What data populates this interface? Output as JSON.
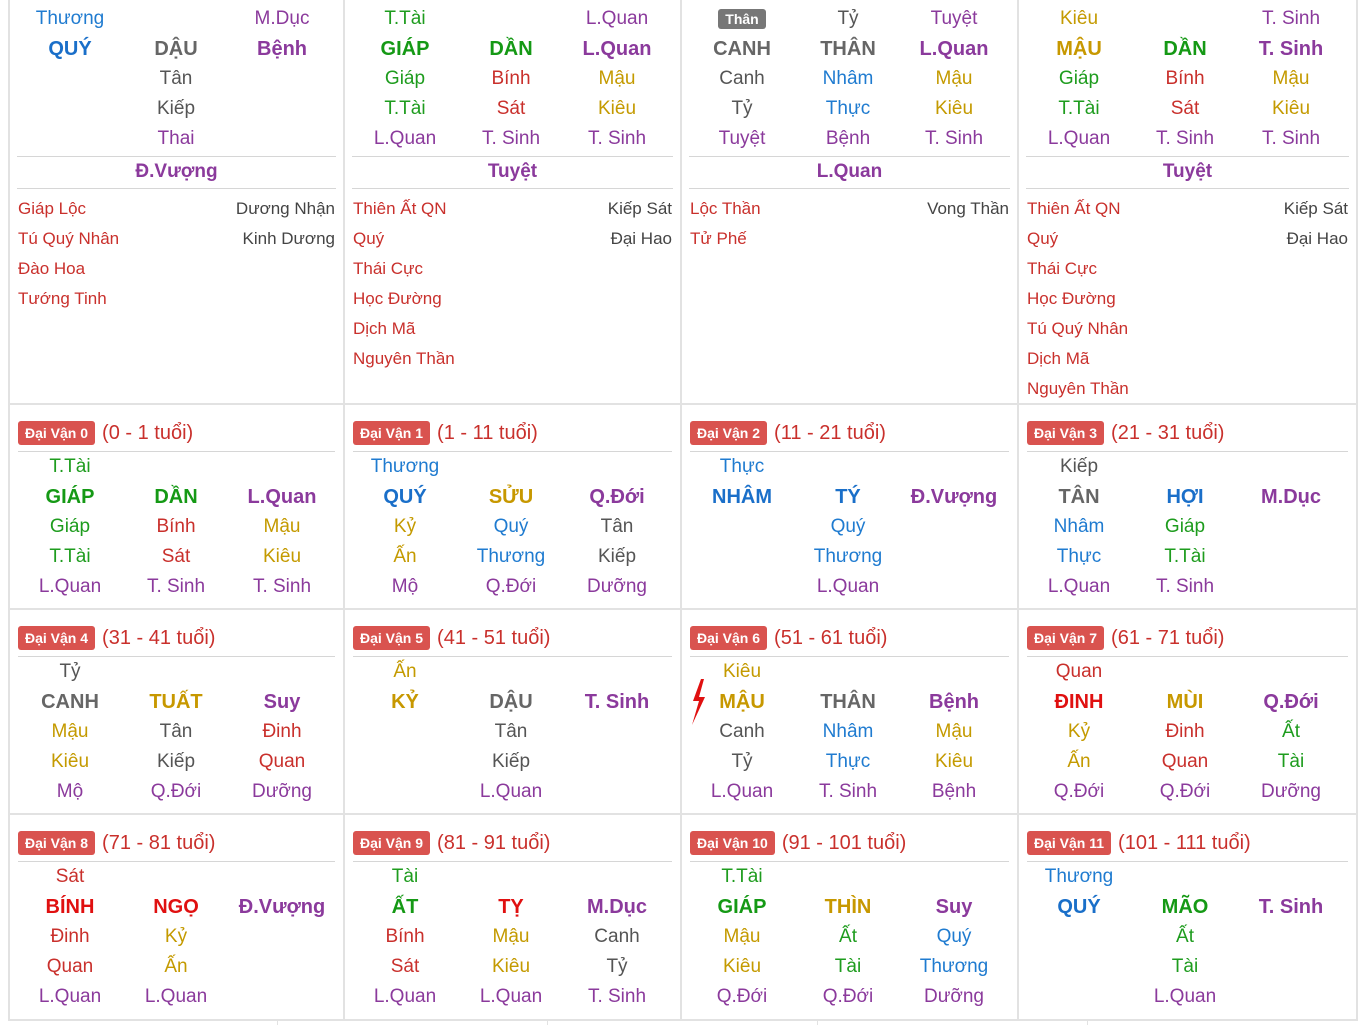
{
  "colors": {
    "red": "#c9302c",
    "pinkred": "#e01010",
    "blue": "#1f7bd0",
    "blue_b": "#1a6fc9",
    "green": "#1e9c1e",
    "green_b": "#159915",
    "olive": "#c49a00",
    "olive_b": "#c79800",
    "gray": "#555555",
    "gray_b": "#666666",
    "purple": "#8b3a9c",
    "purple_b": "#8d2f95",
    "badge": "#d9534f"
  },
  "pillars": [
    {
      "rows": [
        [
          "Thương",
          "",
          "M.Dục"
        ],
        [
          "QUÝ",
          "DẬU",
          "Bệnh"
        ],
        [
          "",
          "Tân",
          ""
        ],
        [
          "",
          "Kiếp",
          ""
        ],
        [
          "",
          "Thai",
          ""
        ]
      ],
      "colors": [
        [
          "blue",
          "",
          "purple"
        ],
        [
          "blue_b",
          "gray_b",
          "purple"
        ],
        [
          "",
          "gray",
          ""
        ],
        [
          "",
          "gray",
          ""
        ],
        [
          "",
          "purple",
          ""
        ]
      ],
      "center": "Đ.Vượng",
      "stars_left": [
        "Giáp Lộc",
        "Tú Quý Nhân",
        "Đào Hoa",
        "Tướng Tinh"
      ],
      "stars_right": [
        "Dương Nhận",
        "Kinh Dương"
      ]
    },
    {
      "rows": [
        [
          "T.Tài",
          "",
          "L.Quan"
        ],
        [
          "GIÁP",
          "DẦN",
          "L.Quan"
        ],
        [
          "Giáp",
          "Bính",
          "Mậu"
        ],
        [
          "T.Tài",
          "Sát",
          "Kiêu"
        ],
        [
          "L.Quan",
          "T. Sinh",
          "T. Sinh"
        ]
      ],
      "colors": [
        [
          "green",
          "",
          "purple"
        ],
        [
          "green_b",
          "green_b",
          "purple"
        ],
        [
          "green",
          "red",
          "olive"
        ],
        [
          "green",
          "red",
          "olive"
        ],
        [
          "purple",
          "purple",
          "purple"
        ]
      ],
      "center": "Tuyệt",
      "stars_left": [
        "Thiên Ất QN",
        "Quý",
        "Thái Cực",
        "Học Đường",
        "Dịch Mã",
        "Nguyên Thần"
      ],
      "stars_right": [
        "Kiếp Sát",
        "Đại Hao"
      ]
    },
    {
      "badge": "Thân",
      "rows": [
        [
          "",
          "Tỷ",
          "Tuyệt"
        ],
        [
          "CANH",
          "THÂN",
          "L.Quan"
        ],
        [
          "Canh",
          "Nhâm",
          "Mậu"
        ],
        [
          "Tỷ",
          "Thực",
          "Kiêu"
        ],
        [
          "Tuyệt",
          "Bệnh",
          "T. Sinh"
        ]
      ],
      "colors": [
        [
          "",
          "gray",
          "purple"
        ],
        [
          "gray_b",
          "gray_b",
          "purple"
        ],
        [
          "gray",
          "blue",
          "olive"
        ],
        [
          "gray",
          "blue",
          "olive"
        ],
        [
          "purple",
          "purple",
          "purple"
        ]
      ],
      "center": "L.Quan",
      "stars_left": [
        "Lộc Thần",
        "Tử Phế"
      ],
      "stars_right": [
        "Vong Thần"
      ]
    },
    {
      "rows": [
        [
          "Kiêu",
          "",
          "T. Sinh"
        ],
        [
          "MẬU",
          "DẦN",
          "T. Sinh"
        ],
        [
          "Giáp",
          "Bính",
          "Mậu"
        ],
        [
          "T.Tài",
          "Sát",
          "Kiêu"
        ],
        [
          "L.Quan",
          "T. Sinh",
          "T. Sinh"
        ]
      ],
      "colors": [
        [
          "olive",
          "",
          "purple"
        ],
        [
          "olive_b",
          "green_b",
          "purple"
        ],
        [
          "green",
          "red",
          "olive"
        ],
        [
          "green",
          "red",
          "olive"
        ],
        [
          "purple",
          "purple",
          "purple"
        ]
      ],
      "center": "Tuyệt",
      "stars_left": [
        "Thiên Ất QN",
        "Quý",
        "Thái Cực",
        "Học Đường",
        "Tú Quý Nhân",
        "Dịch Mã",
        "Nguyên Thần"
      ],
      "stars_right": [
        "Kiếp Sát",
        "Đại Hao"
      ]
    }
  ],
  "dai_van": [
    {
      "label": "Đại Vận 0",
      "age": "(0 - 1 tuổi)",
      "rows": [
        [
          "T.Tài",
          "",
          ""
        ],
        [
          "GIÁP",
          "DẦN",
          "L.Quan"
        ],
        [
          "Giáp",
          "Bính",
          "Mậu"
        ],
        [
          "T.Tài",
          "Sát",
          "Kiêu"
        ],
        [
          "L.Quan",
          "T. Sinh",
          "T. Sinh"
        ]
      ],
      "colors": [
        [
          "green",
          "",
          ""
        ],
        [
          "green_b",
          "green_b",
          "purple"
        ],
        [
          "green",
          "red",
          "olive"
        ],
        [
          "green",
          "red",
          "olive"
        ],
        [
          "purple",
          "purple",
          "purple"
        ]
      ]
    },
    {
      "label": "Đại Vận 1",
      "age": "(1 - 11 tuổi)",
      "rows": [
        [
          "Thương",
          "",
          ""
        ],
        [
          "QUÝ",
          "SỬU",
          "Q.Đới"
        ],
        [
          "Kỷ",
          "Quý",
          "Tân"
        ],
        [
          "Ấn",
          "Thương",
          "Kiếp"
        ],
        [
          "Mộ",
          "Q.Đới",
          "Dưỡng"
        ]
      ],
      "colors": [
        [
          "blue",
          "",
          ""
        ],
        [
          "blue_b",
          "olive_b",
          "purple"
        ],
        [
          "olive",
          "blue",
          "gray"
        ],
        [
          "olive",
          "blue",
          "gray"
        ],
        [
          "purple",
          "purple",
          "purple"
        ]
      ]
    },
    {
      "label": "Đại Vận 2",
      "age": "(11 - 21 tuổi)",
      "rows": [
        [
          "Thực",
          "",
          ""
        ],
        [
          "NHÂM",
          "TÝ",
          "Đ.Vượng"
        ],
        [
          "",
          "Quý",
          ""
        ],
        [
          "",
          "Thương",
          ""
        ],
        [
          "",
          "L.Quan",
          ""
        ]
      ],
      "colors": [
        [
          "blue",
          "",
          ""
        ],
        [
          "blue_b",
          "blue_b",
          "purple"
        ],
        [
          "",
          "blue",
          ""
        ],
        [
          "",
          "blue",
          ""
        ],
        [
          "",
          "purple",
          ""
        ]
      ]
    },
    {
      "label": "Đại Vận 3",
      "age": "(21 - 31 tuổi)",
      "rows": [
        [
          "Kiếp",
          "",
          ""
        ],
        [
          "TÂN",
          "HỢI",
          "M.Dục"
        ],
        [
          "Nhâm",
          "Giáp",
          ""
        ],
        [
          "Thực",
          "T.Tài",
          ""
        ],
        [
          "L.Quan",
          "T. Sinh",
          ""
        ]
      ],
      "colors": [
        [
          "gray",
          "",
          ""
        ],
        [
          "gray_b",
          "blue_b",
          "purple"
        ],
        [
          "blue",
          "green",
          ""
        ],
        [
          "blue",
          "green",
          ""
        ],
        [
          "purple",
          "purple",
          ""
        ]
      ]
    },
    {
      "label": "Đại Vận 4",
      "age": "(31 - 41 tuổi)",
      "rows": [
        [
          "Tỷ",
          "",
          ""
        ],
        [
          "CANH",
          "TUẤT",
          "Suy"
        ],
        [
          "Mậu",
          "Tân",
          "Đinh"
        ],
        [
          "Kiêu",
          "Kiếp",
          "Quan"
        ],
        [
          "Mộ",
          "Q.Đới",
          "Dưỡng"
        ]
      ],
      "colors": [
        [
          "gray",
          "",
          ""
        ],
        [
          "gray_b",
          "olive_b",
          "purple"
        ],
        [
          "olive",
          "gray",
          "red"
        ],
        [
          "olive",
          "gray",
          "red"
        ],
        [
          "purple",
          "purple",
          "purple"
        ]
      ]
    },
    {
      "label": "Đại Vận 5",
      "age": "(41 - 51 tuổi)",
      "rows": [
        [
          "Ấn",
          "",
          ""
        ],
        [
          "KỶ",
          "DẬU",
          "T. Sinh"
        ],
        [
          "",
          "Tân",
          ""
        ],
        [
          "",
          "Kiếp",
          ""
        ],
        [
          "",
          "L.Quan",
          ""
        ]
      ],
      "colors": [
        [
          "olive",
          "",
          ""
        ],
        [
          "olive_b",
          "gray_b",
          "purple"
        ],
        [
          "",
          "gray",
          ""
        ],
        [
          "",
          "gray",
          ""
        ],
        [
          "",
          "purple",
          ""
        ]
      ]
    },
    {
      "label": "Đại Vận 6",
      "age": "(51 - 61 tuổi)",
      "rows": [
        [
          "Kiêu",
          "",
          ""
        ],
        [
          "MẬU",
          "THÂN",
          "Bệnh"
        ],
        [
          "Canh",
          "Nhâm",
          "Mậu"
        ],
        [
          "Tỷ",
          "Thực",
          "Kiêu"
        ],
        [
          "L.Quan",
          "T. Sinh",
          "Bệnh"
        ]
      ],
      "colors": [
        [
          "olive",
          "",
          ""
        ],
        [
          "olive_b",
          "gray_b",
          "purple"
        ],
        [
          "gray",
          "blue",
          "olive"
        ],
        [
          "gray",
          "blue",
          "olive"
        ],
        [
          "purple",
          "purple",
          "purple"
        ]
      ]
    },
    {
      "label": "Đại Vận 7",
      "age": "(61 - 71 tuổi)",
      "rows": [
        [
          "Quan",
          "",
          ""
        ],
        [
          "ĐINH",
          "MÙI",
          "Q.Đới"
        ],
        [
          "Kỷ",
          "Đinh",
          "Ất"
        ],
        [
          "Ấn",
          "Quan",
          "Tài"
        ],
        [
          "Q.Đới",
          "Q.Đới",
          "Dưỡng"
        ]
      ],
      "colors": [
        [
          "red",
          "",
          ""
        ],
        [
          "pinkred",
          "olive_b",
          "purple"
        ],
        [
          "olive",
          "red",
          "green"
        ],
        [
          "olive",
          "red",
          "green"
        ],
        [
          "purple",
          "purple",
          "purple"
        ]
      ]
    },
    {
      "label": "Đại Vận 8",
      "age": "(71 - 81 tuổi)",
      "rows": [
        [
          "Sát",
          "",
          ""
        ],
        [
          "BÍNH",
          "NGỌ",
          "Đ.Vượng"
        ],
        [
          "Đinh",
          "Kỷ",
          ""
        ],
        [
          "Quan",
          "Ấn",
          ""
        ],
        [
          "L.Quan",
          "L.Quan",
          ""
        ]
      ],
      "colors": [
        [
          "red",
          "",
          ""
        ],
        [
          "pinkred",
          "pinkred",
          "purple"
        ],
        [
          "red",
          "olive",
          ""
        ],
        [
          "red",
          "olive",
          ""
        ],
        [
          "purple",
          "purple",
          ""
        ]
      ]
    },
    {
      "label": "Đại Vận 9",
      "age": "(81 - 91 tuổi)",
      "rows": [
        [
          "Tài",
          "",
          ""
        ],
        [
          "ẤT",
          "TỴ",
          "M.Dục"
        ],
        [
          "Bính",
          "Mậu",
          "Canh"
        ],
        [
          "Sát",
          "Kiêu",
          "Tỷ"
        ],
        [
          "L.Quan",
          "L.Quan",
          "T. Sinh"
        ]
      ],
      "colors": [
        [
          "green",
          "",
          ""
        ],
        [
          "green_b",
          "pinkred",
          "purple"
        ],
        [
          "red",
          "olive",
          "gray"
        ],
        [
          "red",
          "olive",
          "gray"
        ],
        [
          "purple",
          "purple",
          "purple"
        ]
      ]
    },
    {
      "label": "Đại Vận 10",
      "age": "(91 - 101 tuổi)",
      "rows": [
        [
          "T.Tài",
          "",
          ""
        ],
        [
          "GIÁP",
          "THÌN",
          "Suy"
        ],
        [
          "Mậu",
          "Ất",
          "Quý"
        ],
        [
          "Kiêu",
          "Tài",
          "Thương"
        ],
        [
          "Q.Đới",
          "Q.Đới",
          "Dưỡng"
        ]
      ],
      "colors": [
        [
          "green",
          "",
          ""
        ],
        [
          "green_b",
          "olive_b",
          "purple"
        ],
        [
          "olive",
          "green",
          "blue"
        ],
        [
          "olive",
          "green",
          "blue"
        ],
        [
          "purple",
          "purple",
          "purple"
        ]
      ]
    },
    {
      "label": "Đại Vận 11",
      "age": "(101 - 111 tuổi)",
      "rows": [
        [
          "Thương",
          "",
          ""
        ],
        [
          "QUÝ",
          "MÃO",
          "T. Sinh"
        ],
        [
          "",
          "Ất",
          ""
        ],
        [
          "",
          "Tài",
          ""
        ],
        [
          "",
          "L.Quan",
          ""
        ]
      ],
      "colors": [
        [
          "blue",
          "",
          ""
        ],
        [
          "blue_b",
          "green_b",
          "purple"
        ],
        [
          "",
          "green",
          ""
        ],
        [
          "",
          "green",
          ""
        ],
        [
          "",
          "purple",
          ""
        ]
      ]
    }
  ]
}
